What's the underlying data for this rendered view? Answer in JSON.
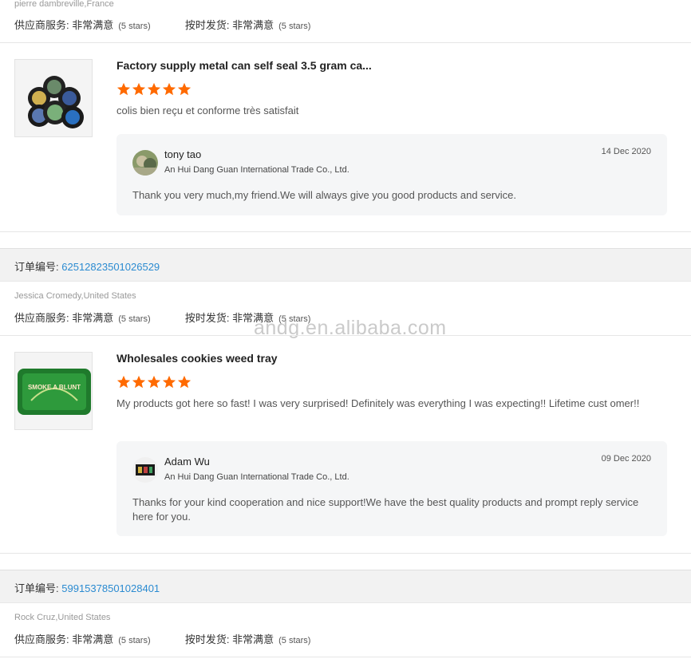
{
  "labels": {
    "supplier_service": "供应商服务:",
    "on_time": "按时发货:",
    "very_satisfied": "非常满意",
    "five_stars": "(5 stars)",
    "order_no": "订单编号:"
  },
  "colors": {
    "star": "#ff6a00",
    "link": "#2b8bd1",
    "order_bar": "#f2f2f2",
    "reply_bg": "#f5f6f7"
  },
  "reviews": [
    {
      "buyer": "pierre dambreville,France",
      "product_title": "Factory supply metal can self seal 3.5 gram ca...",
      "rating": 5,
      "text": "colis bien reçu et conforme très satisfait",
      "reply": {
        "name": "tony tao",
        "company": "An Hui Dang Guan International Trade Co., Ltd.",
        "date": "14 Dec 2020",
        "text": "Thank you very much,my friend.We will always give you good products and service."
      }
    },
    {
      "order_number": "62512823501026529",
      "buyer": "Jessica Cromedy,United States",
      "product_title": "Wholesales cookies weed tray",
      "rating": 5,
      "text": "My products got here so fast! I was very surprised! Definitely was everything I was expecting!! Lifetime cust omer!!",
      "product_image_text": "SMOKE A BLUNT",
      "reply": {
        "name": "Adam Wu",
        "company": "An Hui Dang Guan International Trade Co., Ltd.",
        "date": "09 Dec 2020",
        "text": "Thanks for your kind cooperation and nice support!We have the best quality products and prompt reply service here for you."
      }
    },
    {
      "order_number": "59915378501028401",
      "buyer": "Rock Cruz,United States"
    }
  ],
  "watermark": "andg.en.alibaba.com"
}
